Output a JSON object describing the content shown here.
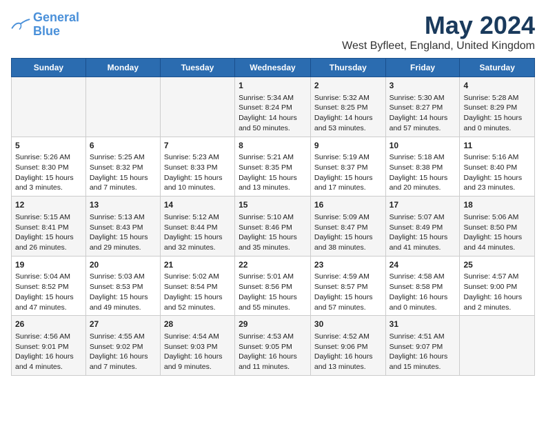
{
  "logo": {
    "line1": "General",
    "line2": "Blue"
  },
  "title": "May 2024",
  "subtitle": "West Byfleet, England, United Kingdom",
  "days_of_week": [
    "Sunday",
    "Monday",
    "Tuesday",
    "Wednesday",
    "Thursday",
    "Friday",
    "Saturday"
  ],
  "weeks": [
    [
      {
        "day": "",
        "info": ""
      },
      {
        "day": "",
        "info": ""
      },
      {
        "day": "",
        "info": ""
      },
      {
        "day": "1",
        "info": "Sunrise: 5:34 AM\nSunset: 8:24 PM\nDaylight: 14 hours\nand 50 minutes."
      },
      {
        "day": "2",
        "info": "Sunrise: 5:32 AM\nSunset: 8:25 PM\nDaylight: 14 hours\nand 53 minutes."
      },
      {
        "day": "3",
        "info": "Sunrise: 5:30 AM\nSunset: 8:27 PM\nDaylight: 14 hours\nand 57 minutes."
      },
      {
        "day": "4",
        "info": "Sunrise: 5:28 AM\nSunset: 8:29 PM\nDaylight: 15 hours\nand 0 minutes."
      }
    ],
    [
      {
        "day": "5",
        "info": "Sunrise: 5:26 AM\nSunset: 8:30 PM\nDaylight: 15 hours\nand 3 minutes."
      },
      {
        "day": "6",
        "info": "Sunrise: 5:25 AM\nSunset: 8:32 PM\nDaylight: 15 hours\nand 7 minutes."
      },
      {
        "day": "7",
        "info": "Sunrise: 5:23 AM\nSunset: 8:33 PM\nDaylight: 15 hours\nand 10 minutes."
      },
      {
        "day": "8",
        "info": "Sunrise: 5:21 AM\nSunset: 8:35 PM\nDaylight: 15 hours\nand 13 minutes."
      },
      {
        "day": "9",
        "info": "Sunrise: 5:19 AM\nSunset: 8:37 PM\nDaylight: 15 hours\nand 17 minutes."
      },
      {
        "day": "10",
        "info": "Sunrise: 5:18 AM\nSunset: 8:38 PM\nDaylight: 15 hours\nand 20 minutes."
      },
      {
        "day": "11",
        "info": "Sunrise: 5:16 AM\nSunset: 8:40 PM\nDaylight: 15 hours\nand 23 minutes."
      }
    ],
    [
      {
        "day": "12",
        "info": "Sunrise: 5:15 AM\nSunset: 8:41 PM\nDaylight: 15 hours\nand 26 minutes."
      },
      {
        "day": "13",
        "info": "Sunrise: 5:13 AM\nSunset: 8:43 PM\nDaylight: 15 hours\nand 29 minutes."
      },
      {
        "day": "14",
        "info": "Sunrise: 5:12 AM\nSunset: 8:44 PM\nDaylight: 15 hours\nand 32 minutes."
      },
      {
        "day": "15",
        "info": "Sunrise: 5:10 AM\nSunset: 8:46 PM\nDaylight: 15 hours\nand 35 minutes."
      },
      {
        "day": "16",
        "info": "Sunrise: 5:09 AM\nSunset: 8:47 PM\nDaylight: 15 hours\nand 38 minutes."
      },
      {
        "day": "17",
        "info": "Sunrise: 5:07 AM\nSunset: 8:49 PM\nDaylight: 15 hours\nand 41 minutes."
      },
      {
        "day": "18",
        "info": "Sunrise: 5:06 AM\nSunset: 8:50 PM\nDaylight: 15 hours\nand 44 minutes."
      }
    ],
    [
      {
        "day": "19",
        "info": "Sunrise: 5:04 AM\nSunset: 8:52 PM\nDaylight: 15 hours\nand 47 minutes."
      },
      {
        "day": "20",
        "info": "Sunrise: 5:03 AM\nSunset: 8:53 PM\nDaylight: 15 hours\nand 49 minutes."
      },
      {
        "day": "21",
        "info": "Sunrise: 5:02 AM\nSunset: 8:54 PM\nDaylight: 15 hours\nand 52 minutes."
      },
      {
        "day": "22",
        "info": "Sunrise: 5:01 AM\nSunset: 8:56 PM\nDaylight: 15 hours\nand 55 minutes."
      },
      {
        "day": "23",
        "info": "Sunrise: 4:59 AM\nSunset: 8:57 PM\nDaylight: 15 hours\nand 57 minutes."
      },
      {
        "day": "24",
        "info": "Sunrise: 4:58 AM\nSunset: 8:58 PM\nDaylight: 16 hours\nand 0 minutes."
      },
      {
        "day": "25",
        "info": "Sunrise: 4:57 AM\nSunset: 9:00 PM\nDaylight: 16 hours\nand 2 minutes."
      }
    ],
    [
      {
        "day": "26",
        "info": "Sunrise: 4:56 AM\nSunset: 9:01 PM\nDaylight: 16 hours\nand 4 minutes."
      },
      {
        "day": "27",
        "info": "Sunrise: 4:55 AM\nSunset: 9:02 PM\nDaylight: 16 hours\nand 7 minutes."
      },
      {
        "day": "28",
        "info": "Sunrise: 4:54 AM\nSunset: 9:03 PM\nDaylight: 16 hours\nand 9 minutes."
      },
      {
        "day": "29",
        "info": "Sunrise: 4:53 AM\nSunset: 9:05 PM\nDaylight: 16 hours\nand 11 minutes."
      },
      {
        "day": "30",
        "info": "Sunrise: 4:52 AM\nSunset: 9:06 PM\nDaylight: 16 hours\nand 13 minutes."
      },
      {
        "day": "31",
        "info": "Sunrise: 4:51 AM\nSunset: 9:07 PM\nDaylight: 16 hours\nand 15 minutes."
      },
      {
        "day": "",
        "info": ""
      }
    ]
  ]
}
